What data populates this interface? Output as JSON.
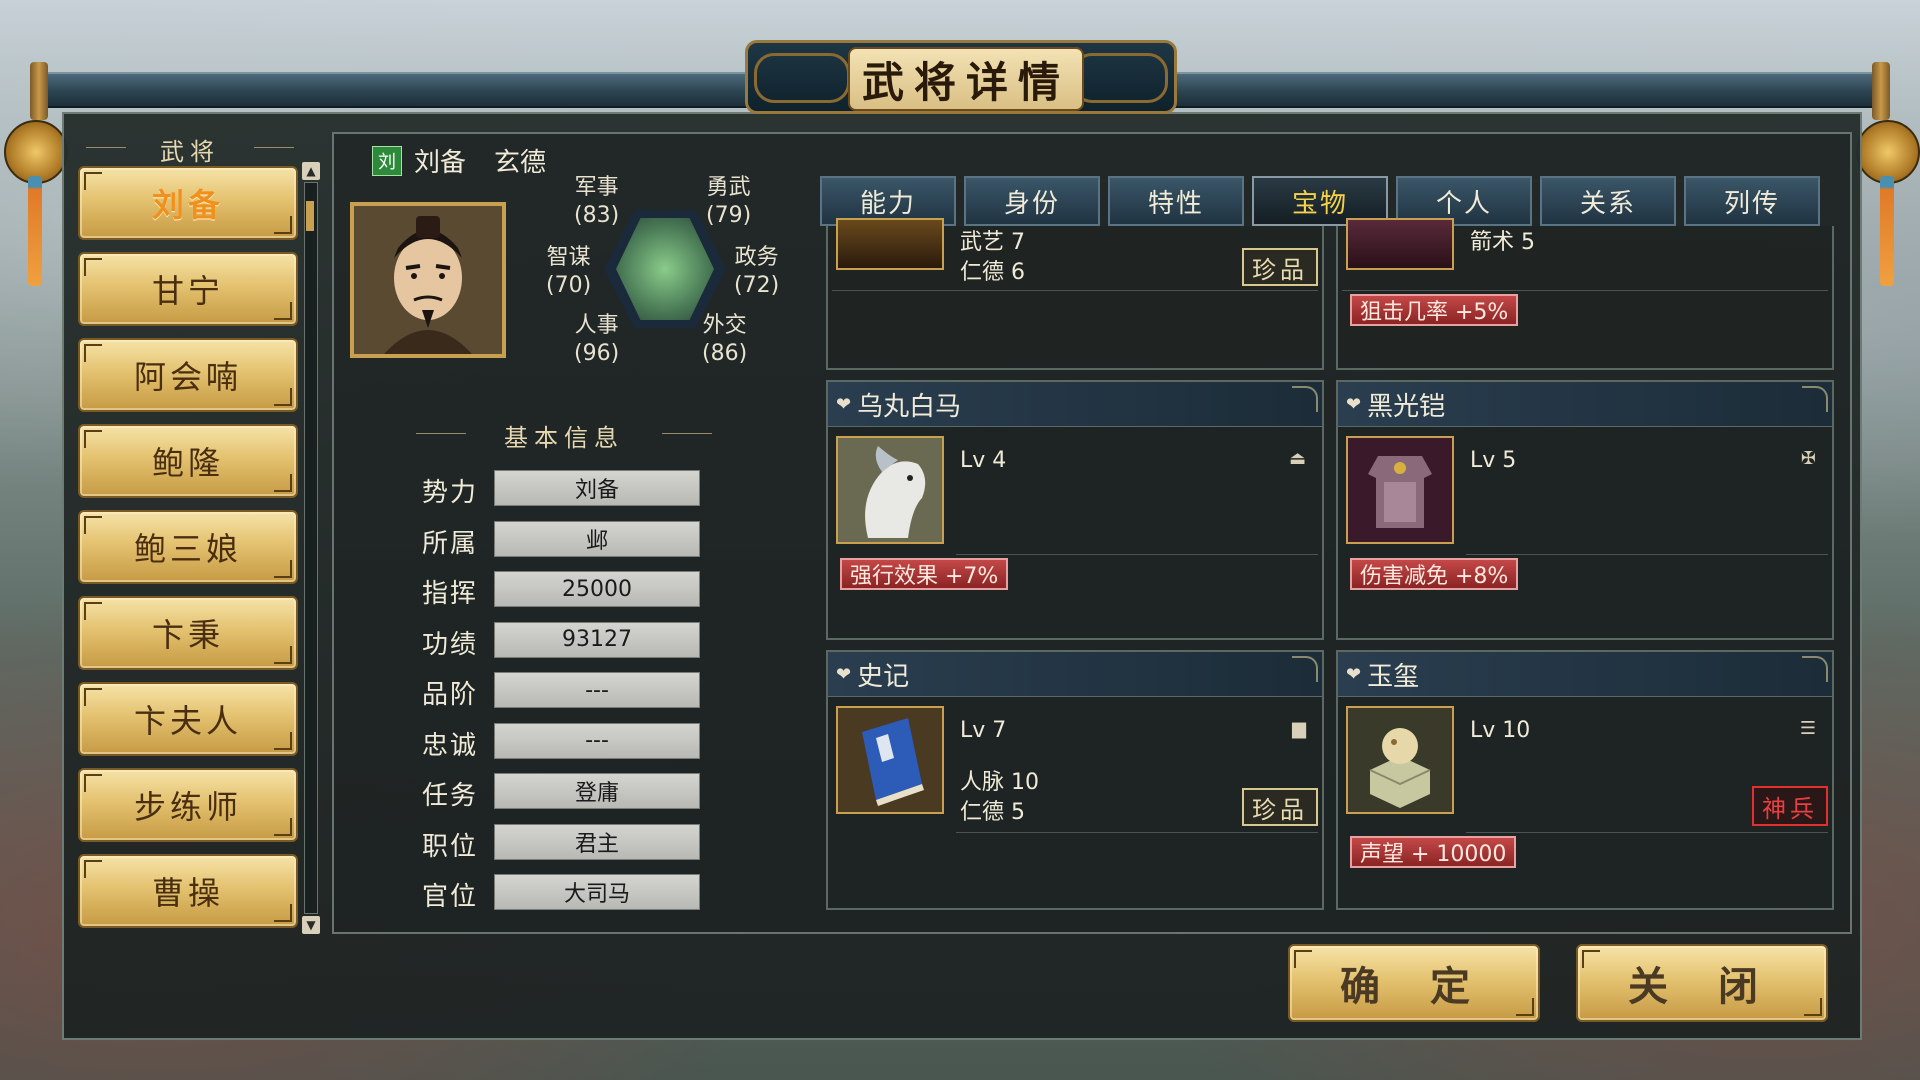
{
  "title": "武将详情",
  "roster": {
    "header": "武将",
    "items": [
      "刘备",
      "甘宁",
      "阿会喃",
      "鲍隆",
      "鲍三娘",
      "卞秉",
      "卞夫人",
      "步练师",
      "曹操"
    ],
    "active_index": 0
  },
  "general": {
    "faction_badge": "刘",
    "name": "刘备",
    "style_name": "玄德",
    "stats": {
      "military_label": "军事",
      "military": "(83)",
      "valor_label": "勇武",
      "valor": "(79)",
      "strategy_label": "智谋",
      "strategy": "(70)",
      "politics_label": "政务",
      "politics": "(72)",
      "personnel_label": "人事",
      "personnel": "(96)",
      "diplomacy_label": "外交",
      "diplomacy": "(86)"
    }
  },
  "basic_info": {
    "header": "基本信息",
    "fields": [
      {
        "label": "势力",
        "value": "刘备"
      },
      {
        "label": "所属",
        "value": "邺"
      },
      {
        "label": "指挥",
        "value": "25000"
      },
      {
        "label": "功绩",
        "value": "93127"
      },
      {
        "label": "品阶",
        "value": "---"
      },
      {
        "label": "忠诚",
        "value": "---"
      },
      {
        "label": "任务",
        "value": "登庸"
      },
      {
        "label": "职位",
        "value": "君主"
      },
      {
        "label": "官位",
        "value": "大司马"
      }
    ]
  },
  "tabs": [
    "能力",
    "身份",
    "特性",
    "宝物",
    "个人",
    "关系",
    "列传"
  ],
  "active_tab": "宝物",
  "treasures": {
    "partial_top_left": {
      "attr1": "武艺 7",
      "attr2": "仁德 6",
      "rarity": "珍品"
    },
    "partial_top_right": {
      "attr1": "箭术 5",
      "bonus": "狙击几率 +5%"
    },
    "items": [
      {
        "name": "乌丸白马",
        "level": "Lv 4",
        "type_icon": "horse-icon",
        "bonus": "强行效果 +7%"
      },
      {
        "name": "黑光铠",
        "level": "Lv 5",
        "type_icon": "armor-icon",
        "bonus": "伤害减免 +8%"
      },
      {
        "name": "史记",
        "level": "Lv 7",
        "type_icon": "book-icon",
        "attr1": "人脉 10",
        "attr2": "仁德 5",
        "rarity": "珍品"
      },
      {
        "name": "玉玺",
        "level": "Lv 10",
        "type_icon": "seal-icon",
        "rarity": "神兵",
        "bonus": "声望 + 10000"
      }
    ]
  },
  "buttons": {
    "confirm": "确 定",
    "close": "关 闭"
  },
  "colors": {
    "gold_button": "#e4c270",
    "active_text": "#f0901e",
    "tab_active": "#f6d24a",
    "bonus_red": "#c44848",
    "divine_red": "#e03030"
  }
}
